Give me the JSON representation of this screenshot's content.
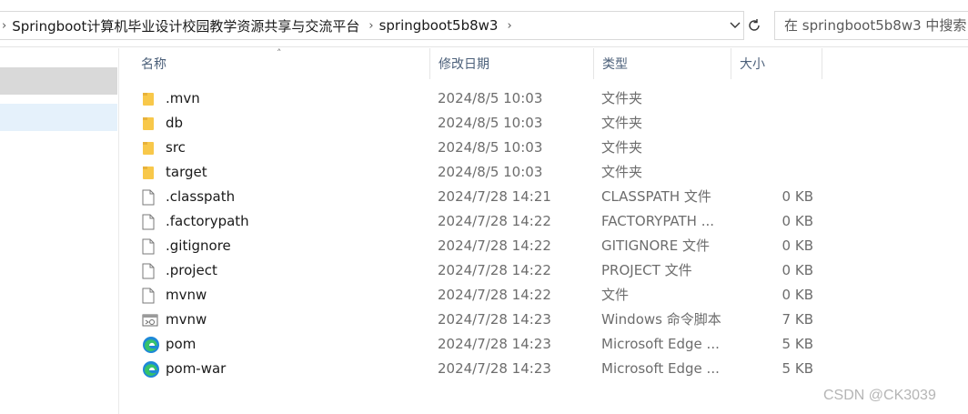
{
  "address": {
    "path": [
      "Springboot计算机毕业设计校园教学资源共享与交流平台",
      "springboot5b8w3"
    ]
  },
  "search": {
    "placeholder": "在 springboot5b8w3 中搜索"
  },
  "columns": {
    "name": "名称",
    "date": "修改日期",
    "type": "类型",
    "size": "大小"
  },
  "files": [
    {
      "name": ".mvn",
      "date": "2024/8/5 10:03",
      "type": "文件夹",
      "size": "",
      "icon": "folder-icon"
    },
    {
      "name": "db",
      "date": "2024/8/5 10:03",
      "type": "文件夹",
      "size": "",
      "icon": "folder-icon"
    },
    {
      "name": "src",
      "date": "2024/8/5 10:03",
      "type": "文件夹",
      "size": "",
      "icon": "folder-icon"
    },
    {
      "name": "target",
      "date": "2024/8/5 10:03",
      "type": "文件夹",
      "size": "",
      "icon": "folder-icon"
    },
    {
      "name": ".classpath",
      "date": "2024/7/28 14:21",
      "type": "CLASSPATH 文件",
      "size": "0 KB",
      "icon": "file-icon"
    },
    {
      "name": ".factorypath",
      "date": "2024/7/28 14:22",
      "type": "FACTORYPATH ...",
      "size": "0 KB",
      "icon": "file-icon"
    },
    {
      "name": ".gitignore",
      "date": "2024/7/28 14:22",
      "type": "GITIGNORE 文件",
      "size": "0 KB",
      "icon": "file-icon"
    },
    {
      "name": ".project",
      "date": "2024/7/28 14:22",
      "type": "PROJECT 文件",
      "size": "0 KB",
      "icon": "file-icon"
    },
    {
      "name": "mvnw",
      "date": "2024/7/28 14:22",
      "type": "文件",
      "size": "0 KB",
      "icon": "file-icon"
    },
    {
      "name": "mvnw",
      "date": "2024/7/28 14:23",
      "type": "Windows 命令脚本",
      "size": "7 KB",
      "icon": "script-icon"
    },
    {
      "name": "pom",
      "date": "2024/7/28 14:23",
      "type": "Microsoft Edge ...",
      "size": "5 KB",
      "icon": "edge-icon"
    },
    {
      "name": "pom-war",
      "date": "2024/7/28 14:23",
      "type": "Microsoft Edge ...",
      "size": "5 KB",
      "icon": "edge-icon"
    }
  ],
  "watermark": "CSDN @CK3039",
  "colors": {
    "folder": "#f8c84a",
    "header_text": "#4c607a",
    "nav_selected": "#e5f1fb",
    "nav_hover": "#d9d9d9"
  }
}
